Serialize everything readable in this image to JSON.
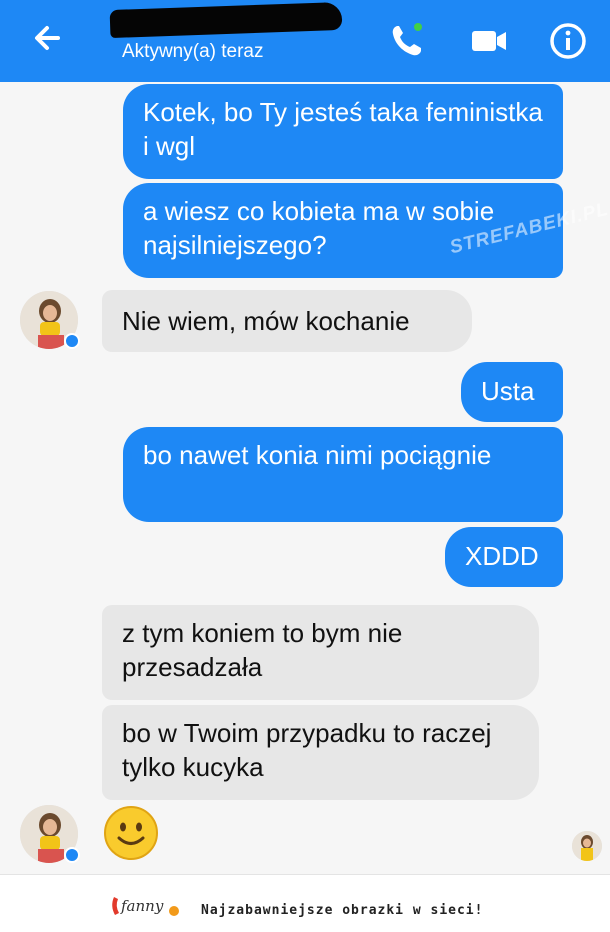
{
  "header": {
    "status": "Aktywny(a) teraz",
    "back_icon": "arrow-left-icon",
    "call_icon": "phone-icon",
    "video_icon": "video-camera-icon",
    "info_icon": "info-icon",
    "bg_color": "#1e88f5"
  },
  "messages": [
    {
      "from": "me",
      "text": "Kotek, bo Ty jesteś taka feministka i wgl"
    },
    {
      "from": "me",
      "text": "a wiesz co kobieta ma w sobie najsilniejszego?"
    },
    {
      "from": "them",
      "text": "Nie wiem, mów kochanie"
    },
    {
      "from": "me",
      "text": "Usta"
    },
    {
      "from": "me",
      "text": "bo nawet konia nimi pociągnie"
    },
    {
      "from": "me",
      "text": "XDDD"
    },
    {
      "from": "them",
      "text": "z tym koniem to bym nie przesadzała"
    },
    {
      "from": "them",
      "text": "bo w Twoim przypadku to raczej tylko kucyka"
    },
    {
      "from": "them",
      "type": "emoji",
      "icon": "slightly-smiling-face-icon"
    }
  ],
  "watermark": "STREFABEKI.PL",
  "footer": {
    "logo_text": "fanny",
    "tagline": "Najzabawniejsze obrazki w sieci!"
  },
  "colors": {
    "sent_bubble": "#1e88f5",
    "received_bubble": "#e7e7e7"
  }
}
